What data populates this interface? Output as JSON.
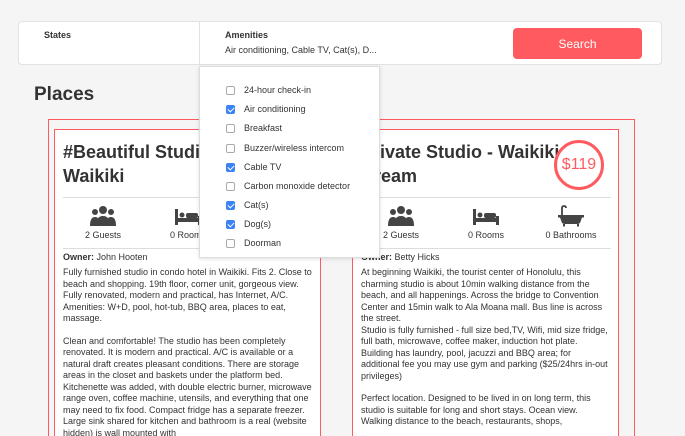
{
  "filters": {
    "states_title": "States",
    "amenities_title": "Amenities",
    "amenities_selected": "Air conditioning, Cable TV, Cat(s), D...",
    "search_label": "Search"
  },
  "places_title": "Places",
  "cards": [
    {
      "name": "#Beautiful Studio Waikiki",
      "price": "",
      "guests": "2 Guests",
      "rooms": "0 Rooms",
      "bathrooms": "",
      "owner_label": "Owner",
      "owner": "John Hooten",
      "desc_p1": "Fully furnished studio in condo hotel in Waikiki. Fits 2. Close to beach and shopping. 19th floor, corner unit, gorgeous view. Fully renovated, modern and practical, has Internet, A/C. Amenities: W+D, pool, hot-tub, BBQ area, places to eat, massage.",
      "desc_p2": "Clean and comfortable! The studio has been completely renovated. It is modern and practical. A/C is available or a natural draft creates pleasant conditions. There are storage areas in the closet and baskets under the platform bed. Kitchenette was added, with double electric burner, microwave range oven, coffee machine, utensils, and everything that one may need to fix food. Compact fridge has a separate freezer. Large sink shared for kitchen and bathroom is a real (website hidden) is wall mounted with"
    },
    {
      "name": "Private Studio - Waikiki Dream",
      "price": "$119",
      "guests": "2 Guests",
      "rooms": "0 Rooms",
      "bathrooms": "0 Bathrooms",
      "owner_label": "Owner",
      "owner": "Betty Hicks",
      "desc_p1": "At beginning Waikiki, the tourist center of Honolulu, this charming studio is about 10min walking distance from the beach, and all happenings. Across the bridge to Convention Center and 15min walk to Ala Moana mall. Bus line is across the street.\nStudio is fully furnished - full size bed,TV, Wifi, mid size fridge, full bath, microwave, coffee maker, induction hot plate. Building has laundry, pool, jacuzzi and BBQ area; for additional fee you may use gym and parking ($25/24hrs in-out privileges)",
      "desc_p2": "Perfect location. Designed to be lived in on long term, this studio is suitable for long and short stays. Ocean view. Walking distance to the beach, restaurants, shops,"
    }
  ],
  "amenities": [
    {
      "label": "24-hour check-in",
      "checked": false
    },
    {
      "label": "Air conditioning",
      "checked": true
    },
    {
      "label": "Breakfast",
      "checked": false
    },
    {
      "label": "Buzzer/wireless intercom",
      "checked": false
    },
    {
      "label": "Cable TV",
      "checked": true
    },
    {
      "label": "Carbon monoxide detector",
      "checked": false
    },
    {
      "label": "Cat(s)",
      "checked": true
    },
    {
      "label": "Dog(s)",
      "checked": true
    },
    {
      "label": "Doorman",
      "checked": false
    }
  ],
  "colors": {
    "accent": "#ff5a5f",
    "checkbox": "#3b82f6"
  }
}
